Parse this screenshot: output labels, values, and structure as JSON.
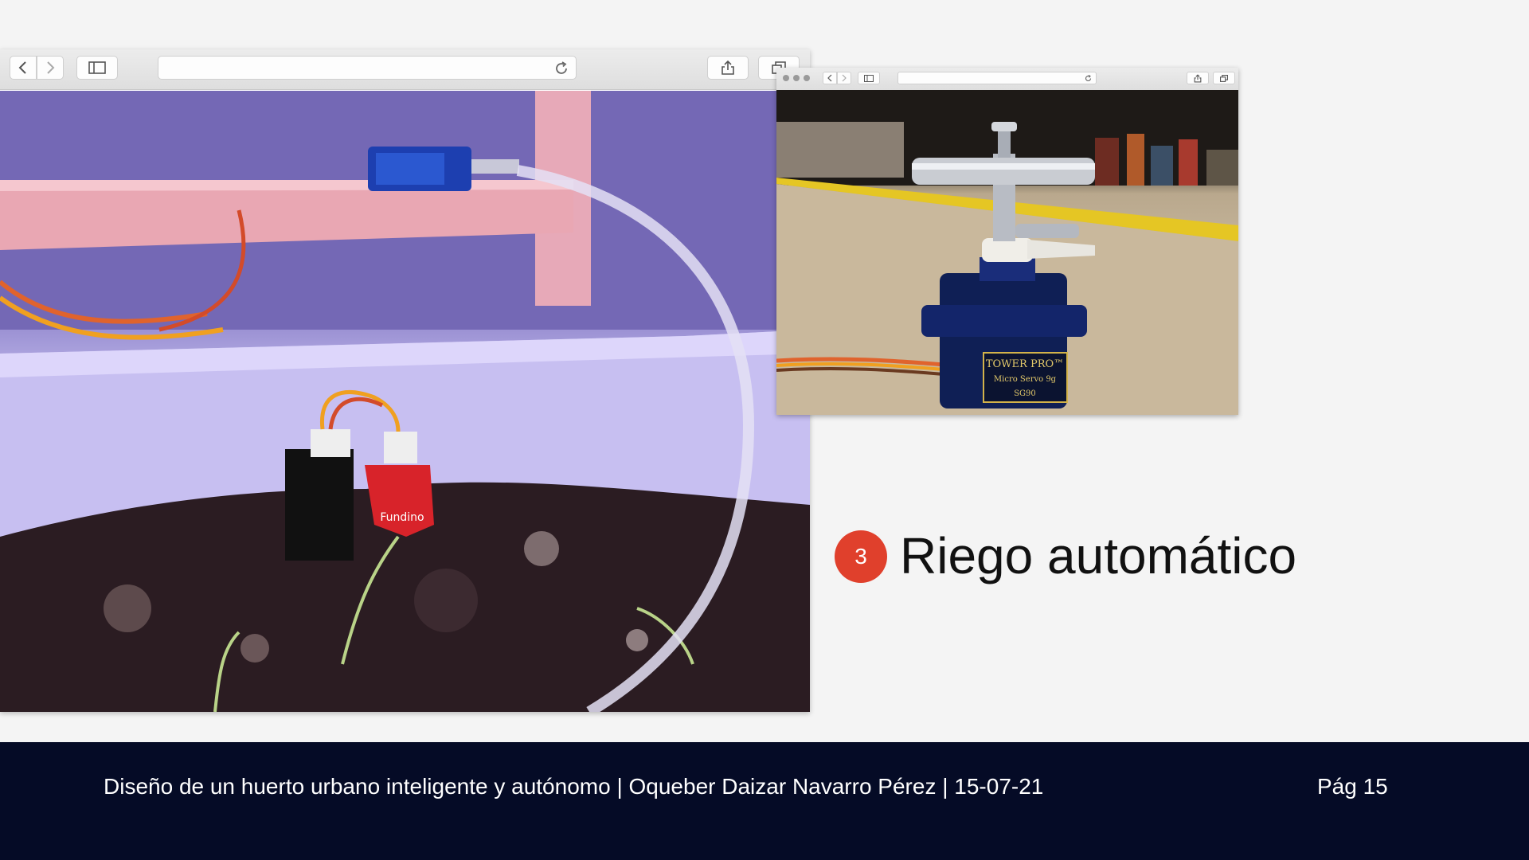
{
  "slide": {
    "step_number": "3",
    "heading": "Riego automático"
  },
  "footer": {
    "text": "Diseño de un huerto urbano inteligente y autónomo | Oqueber Daizar Navarro Pérez | 15-07-21",
    "page": "Pág 15"
  },
  "photos": {
    "servo_label_brand": "TOWER PRO™",
    "servo_label_model": "Micro Servo 9g",
    "servo_label_code": "SG90",
    "sensor_label": "Fundino"
  },
  "icons": {
    "back": "chevron-left-icon",
    "forward": "chevron-right-icon",
    "sidebar": "sidebar-icon",
    "reload": "reload-icon",
    "share": "share-icon",
    "tabs": "tabs-icon"
  },
  "colors": {
    "badge": "#e0402c",
    "footer_bg": "#050b26",
    "page_bg": "#f4f4f4"
  }
}
